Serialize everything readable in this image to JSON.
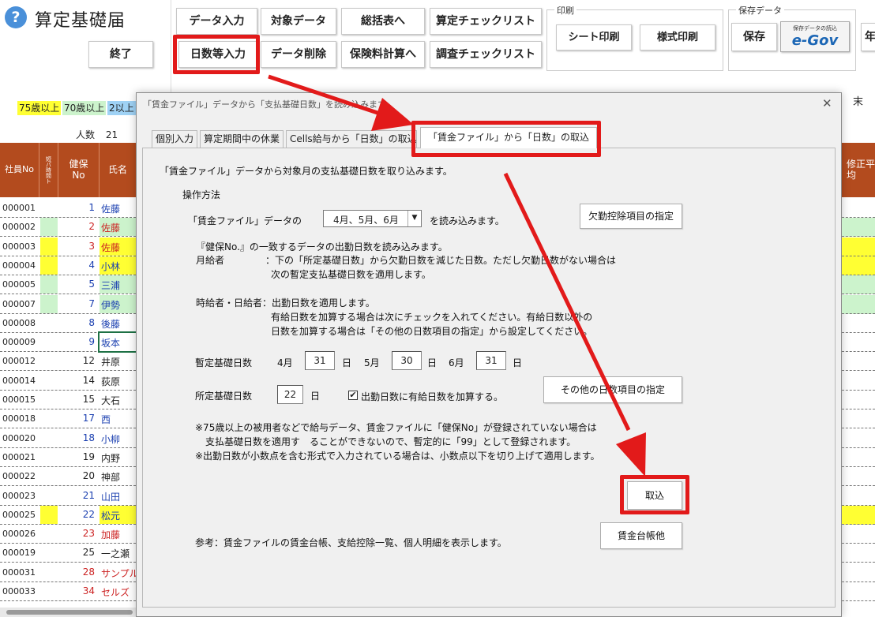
{
  "app": {
    "help_icon": "question-circle-icon",
    "title": "算定基礎届",
    "exit_label": "終了"
  },
  "toolbar": {
    "data_input": "データ入力",
    "target_data": "対象データ",
    "to_summary": "総括表へ",
    "calc_checklist": "算定チェックリスト",
    "days_input": "日数等入力",
    "data_delete": "データ削除",
    "premium_calc": "保険料計算へ",
    "survey_checklist": "調査チェックリスト",
    "print_group": "印刷",
    "sheet_print": "シート印刷",
    "form_print": "様式印刷",
    "save_group": "保存データ",
    "save": "保存",
    "egov_small": "保存データの読込",
    "egov_logo": "e-Gov",
    "year_partial": "年"
  },
  "legend": {
    "age75": "75歳以上",
    "age70": "70歳以上",
    "age2": "2以上"
  },
  "count": {
    "label": "人数",
    "value": "21"
  },
  "header": {
    "emp_no": "社員No",
    "part_time": "短パ時間ト",
    "health_no": "健保No",
    "name": "氏名",
    "right_col": "修正平均",
    "end_partial": "末"
  },
  "rows": [
    {
      "id": "000001",
      "no": "1",
      "name": "佐藤",
      "mark": "",
      "name_bg": "",
      "name_color": "#1a3fb0",
      "no_color": "#1a3fb0"
    },
    {
      "id": "000002",
      "no": "2",
      "name": "佐藤",
      "mark": "#ccf3cc",
      "name_bg": "#ccf3cc",
      "name_color": "#cc2222",
      "no_color": "#cc2222"
    },
    {
      "id": "000003",
      "no": "3",
      "name": "佐藤",
      "mark": "#ffff33",
      "name_bg": "#ffff33",
      "name_color": "#cc2222",
      "no_color": "#cc2222"
    },
    {
      "id": "000004",
      "no": "4",
      "name": "小林",
      "mark": "#ffff33",
      "name_bg": "#ffff33",
      "name_color": "#1a3fb0",
      "no_color": "#1a3fb0"
    },
    {
      "id": "000005",
      "no": "5",
      "name": "三浦",
      "mark": "#ccf3cc",
      "name_bg": "#ccf3cc",
      "name_color": "#1a3fb0",
      "no_color": "#1a3fb0"
    },
    {
      "id": "000007",
      "no": "7",
      "name": "伊勢",
      "mark": "#ccf3cc",
      "name_bg": "#ccf3cc",
      "name_color": "#1a3fb0",
      "no_color": "#1a3fb0"
    },
    {
      "id": "000008",
      "no": "8",
      "name": "後藤",
      "mark": "",
      "name_bg": "",
      "name_color": "#1a3fb0",
      "no_color": "#1a3fb0"
    },
    {
      "id": "000009",
      "no": "9",
      "name": "坂本",
      "mark": "",
      "name_bg": "",
      "name_color": "#1a3fb0",
      "no_color": "#1a3fb0"
    },
    {
      "id": "000012",
      "no": "12",
      "name": "井原",
      "mark": "",
      "name_bg": "",
      "name_color": "#222",
      "no_color": "#222"
    },
    {
      "id": "000014",
      "no": "14",
      "name": "荻原",
      "mark": "",
      "name_bg": "",
      "name_color": "#222",
      "no_color": "#222"
    },
    {
      "id": "000015",
      "no": "15",
      "name": "大石",
      "mark": "",
      "name_bg": "",
      "name_color": "#222",
      "no_color": "#222"
    },
    {
      "id": "000018",
      "no": "17",
      "name": "西",
      "mark": "",
      "name_bg": "",
      "name_color": "#1a3fb0",
      "no_color": "#1a3fb0"
    },
    {
      "id": "000020",
      "no": "18",
      "name": "小柳",
      "mark": "",
      "name_bg": "",
      "name_color": "#1a3fb0",
      "no_color": "#1a3fb0"
    },
    {
      "id": "000021",
      "no": "19",
      "name": "内野",
      "mark": "",
      "name_bg": "",
      "name_color": "#222",
      "no_color": "#222"
    },
    {
      "id": "000022",
      "no": "20",
      "name": "神部",
      "mark": "",
      "name_bg": "",
      "name_color": "#222",
      "no_color": "#222"
    },
    {
      "id": "000023",
      "no": "21",
      "name": "山田",
      "mark": "",
      "name_bg": "",
      "name_color": "#1a3fb0",
      "no_color": "#1a3fb0"
    },
    {
      "id": "000025",
      "no": "22",
      "name": "松元",
      "mark": "#ffff33",
      "name_bg": "#ffff33",
      "name_color": "#1a3fb0",
      "no_color": "#1a3fb0"
    },
    {
      "id": "000026",
      "no": "23",
      "name": "加藤",
      "mark": "",
      "name_bg": "",
      "name_color": "#cc2222",
      "no_color": "#cc2222"
    },
    {
      "id": "000019",
      "no": "25",
      "name": "一之瀬",
      "mark": "",
      "name_bg": "",
      "name_color": "#222",
      "no_color": "#222"
    },
    {
      "id": "000031",
      "no": "28",
      "name": "サンプル",
      "mark": "",
      "name_bg": "",
      "name_color": "#cc2222",
      "no_color": "#cc2222"
    },
    {
      "id": "000033",
      "no": "34",
      "name": "セルズ",
      "mark": "",
      "name_bg": "",
      "name_color": "#cc2222",
      "no_color": "#cc2222"
    }
  ],
  "right_rows": [
    "",
    "#ccf3cc",
    "#ffff33",
    "#ffff33",
    "#ccf3cc",
    "#ccf3cc",
    "",
    "",
    "",
    "",
    "",
    "",
    "",
    "",
    "",
    "",
    "#ffff33",
    "",
    "",
    "",
    ""
  ],
  "dialog": {
    "title": "「賃金ファイル」データから「支払基礎日数」を読み込みます",
    "close_icon": "close-icon",
    "tabs": [
      "個別入力",
      "算定期間中の休業",
      "Cells給与から「日数」の取込",
      "「賃金ファイル」から「日数」の取込"
    ],
    "intro": "「賃金ファイル」データから対象月の支払基礎日数を取り込みます。",
    "procedure": "操作方法",
    "data_prefix": "「賃金ファイル」データの",
    "months_selected": "4月、5月、6月",
    "data_suffix": "を読み込みます。",
    "absence_btn": "欠勤控除項目の指定",
    "line_match": "『健保No.』の一致するデータの出勤日数を読み込みます。",
    "monthly_label": "月給者",
    "monthly_text1": "：下の「所定基礎日数」から欠勤日数を減じた日数。ただし欠勤日数がない場合は",
    "monthly_text2": "次の暫定支払基礎日数を適用します。",
    "hourly_label": "時給者・日給者：出勤日数を適用します。",
    "hourly_text1": "有給日数を加算する場合は次にチェックを入れてください。有給日数以外の",
    "hourly_text2": "日数を加算する場合は「その他の日数項目の指定」から設定してください。",
    "provisional_label": "暫定基礎日数",
    "m4": "4月",
    "d4": "31",
    "m5": "5月",
    "d5": "30",
    "m6": "6月",
    "d6": "31",
    "day_unit": "日",
    "fixed_label": "所定基礎日数",
    "fixed_value": "22",
    "paid_leave_check": "✔",
    "paid_leave_label": "出勤日数に有給日数を加算する。",
    "other_btn": "その他の日数項目の指定",
    "note1": "※75歳以上の被用者などで給与データ、賃金ファイルに「健保No」が登録されていない場合は",
    "note2": "支払基礎日数を適用す　ることができないので、暫定的に「99」として登録されます。",
    "note3": "※出勤日数が小数点を含む形式で入力されている場合は、小数点以下を切り上げて適用します。",
    "import_btn": "取込",
    "ref_text": "参考：賃金ファイルの賃金台帳、支給控除一覧、個人明細を表示します。",
    "ledger_btn": "賃金台帳他"
  },
  "colors": {
    "header_brown": "#b34b1e",
    "highlight_red": "#e21a1a",
    "legend_yellow": "#ffff33",
    "legend_green": "#ccf3cc",
    "legend_blue": "#9fd2f5"
  }
}
